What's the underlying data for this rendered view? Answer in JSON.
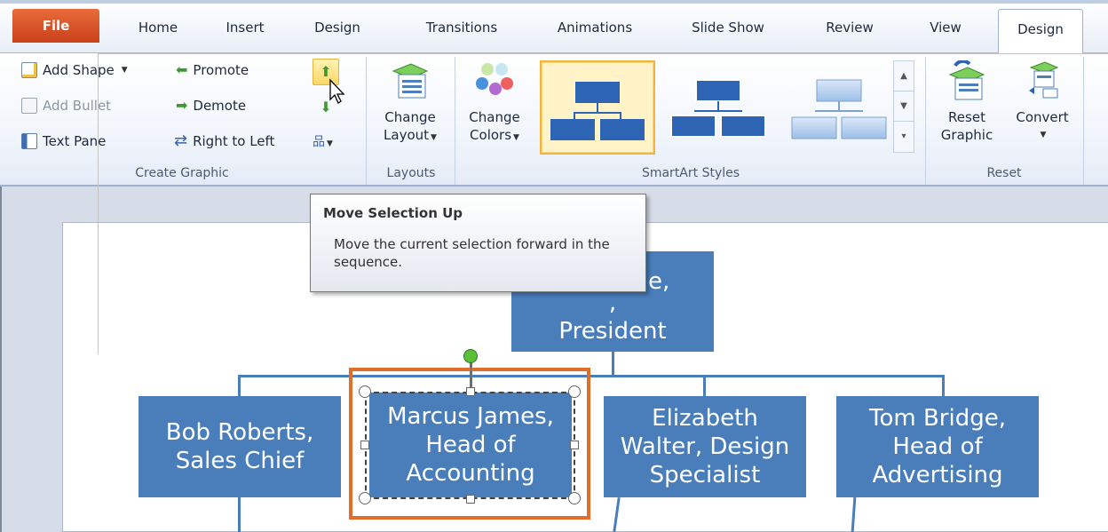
{
  "tabs": {
    "file": "File",
    "home": "Home",
    "insert": "Insert",
    "design": "Design",
    "transitions": "Transitions",
    "animations": "Animations",
    "slide_show": "Slide Show",
    "review": "Review",
    "view": "View",
    "smartart_design": "Design"
  },
  "create_graphic": {
    "add_shape": "Add Shape",
    "add_bullet": "Add Bullet",
    "text_pane": "Text Pane",
    "promote": "Promote",
    "demote": "Demote",
    "right_to_left": "Right to Left",
    "label": "Create Graphic"
  },
  "layouts": {
    "change_layout_1": "Change",
    "change_layout_2": "Layout",
    "label": "Layouts"
  },
  "smartart_styles": {
    "change_colors_1": "Change",
    "change_colors_2": "Colors",
    "label": "SmartArt Styles"
  },
  "reset": {
    "reset_1": "Reset",
    "reset_2": "Graphic",
    "convert": "Convert",
    "label": "Reset"
  },
  "tooltip": {
    "title": "Move Selection Up",
    "body": "Move the current selection forward in the sequence."
  },
  "org_chart": {
    "top_box": ",\nPresident",
    "top_box_fragment": "e,",
    "children": [
      "Bob Roberts,\nSales Chief",
      "Marcus James,\nHead of\nAccounting",
      "Elizabeth\nWalter, Design\nSpecialist",
      "Tom Bridge,\nHead of\nAdvertising"
    ]
  },
  "colors": {
    "box_fill": "#4a7ebb",
    "selection_outline": "#e06e2a",
    "file_tab": "#d65529",
    "rotation_handle": "#5bbf3a"
  }
}
